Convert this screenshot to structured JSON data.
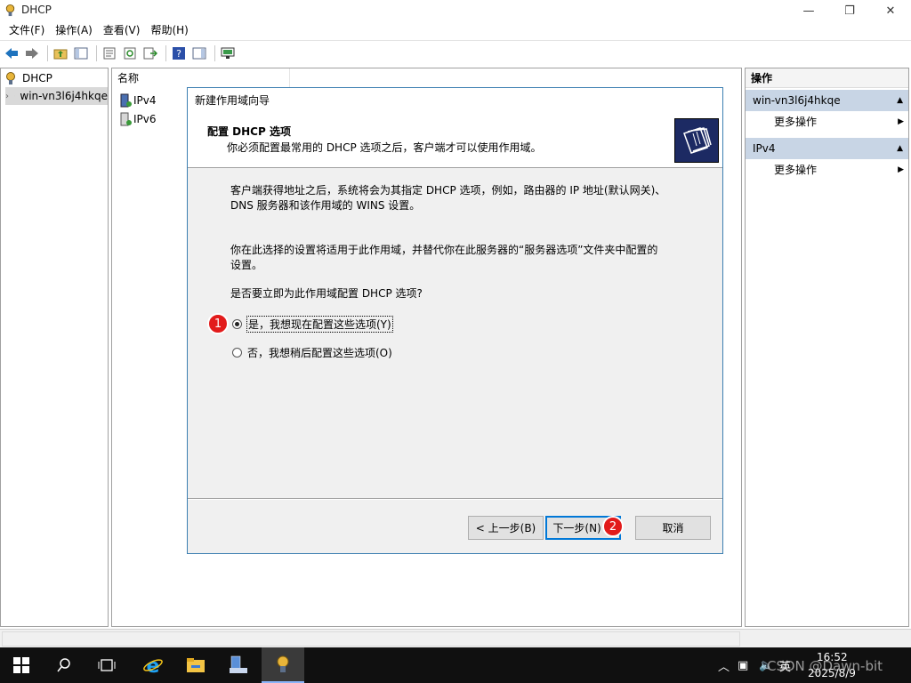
{
  "window": {
    "title": "DHCP",
    "min": "—",
    "max": "❐",
    "close": "✕"
  },
  "menu": [
    "文件(F)",
    "操作(A)",
    "查看(V)",
    "帮助(H)"
  ],
  "tree": {
    "root": "DHCP",
    "server": "win-vn3l6j4hkqe"
  },
  "list": {
    "header": "名称",
    "items": [
      "IPv4",
      "IPv6"
    ]
  },
  "actions": {
    "header": "操作",
    "groups": [
      {
        "title": "win-vn3l6j4hkqe",
        "item": "更多操作"
      },
      {
        "title": "IPv4",
        "item": "更多操作"
      }
    ]
  },
  "wizard": {
    "title": "新建作用域向导",
    "heading": "配置 DHCP 选项",
    "subheading": "你必须配置最常用的 DHCP 选项之后，客户端才可以使用作用域。",
    "para1_line1": "客户端获得地址之后，系统将会为其指定 DHCP 选项，例如，路由器的 IP 地址(默认网关)、",
    "para1_line2": "DNS 服务器和该作用域的 WINS 设置。",
    "para2_line1": "你在此选择的设置将适用于此作用域，并替代你在此服务器的“服务器选项”文件夹中配置的",
    "para2_line2": "设置。",
    "question": "是否要立即为此作用域配置 DHCP 选项?",
    "option_yes": "是，我想现在配置这些选项(Y)",
    "option_no": "否，我想稍后配置这些选项(O)",
    "selected": "yes",
    "back": "< 上一步(B)",
    "next": "下一步(N) >",
    "cancel": "取消"
  },
  "markers": [
    "1",
    "2"
  ],
  "taskbar": {
    "time": "16:52",
    "date": "2025/8/9",
    "ime": "英"
  },
  "watermark": "CSDN @Dawn-bit",
  "colors": {
    "accent": "#0078d7",
    "marker": "#e21b1b",
    "action_group": "#c8d5e5"
  }
}
